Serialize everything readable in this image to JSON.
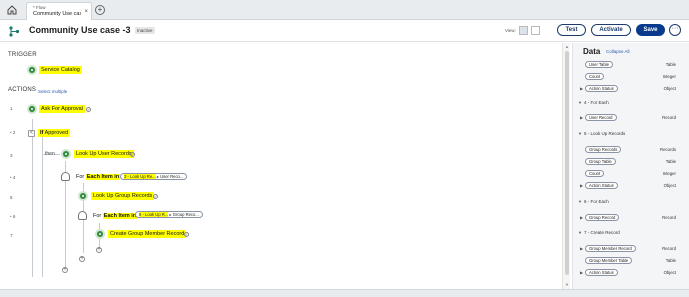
{
  "tab": {
    "subtitle": "* Flow",
    "title": "Community Use cas...",
    "close": "×"
  },
  "header": {
    "title": "Community Use case -3",
    "status": "Inactive",
    "view_label": "View:",
    "test_label": "Test",
    "activate_label": "Activate",
    "save_label": "Save",
    "more_label": "···"
  },
  "canvas": {
    "trigger_label": "TRIGGER",
    "trigger_name": "Service Catalog",
    "actions_label": "ACTIONS",
    "select_multiple": "Select multiple",
    "then_label": "then",
    "rows": [
      {
        "num": "1",
        "label": "Ask For Approval"
      },
      {
        "num": "2",
        "if_keyword": "If",
        "label": "Approved"
      },
      {
        "num": "3",
        "label": "Look Up User Records"
      },
      {
        "num": "4",
        "for_prefix": "For",
        "for_bold": "Each Item in",
        "pill_hl": "3 - Look Up Re...",
        "pill_rest": "User Reco..."
      },
      {
        "num": "5",
        "label": "Look Up Group Records"
      },
      {
        "num": "6",
        "for_prefix": "For",
        "for_bold": "Each Item in",
        "pill_hl": "5 - Look Up R...",
        "pill_rest": "Group Reco..."
      },
      {
        "num": "7",
        "label": "Create Group Member Record"
      }
    ]
  },
  "panel": {
    "title": "Data",
    "collapse_all": "Collapse All",
    "top_items": [
      {
        "label": "User Table",
        "type": "Table"
      },
      {
        "label": "Count",
        "type": "Integer"
      },
      {
        "label": "Action Status",
        "type": "Object"
      }
    ],
    "sections": [
      {
        "title": "4 - For Each",
        "items": [
          {
            "label": "User Record",
            "type": "Record"
          }
        ]
      },
      {
        "title": "5 - Look Up Records",
        "items": [
          {
            "label": "Group Records",
            "type": "Records"
          },
          {
            "label": "Group Table",
            "type": "Table"
          },
          {
            "label": "Count",
            "type": "Integer"
          },
          {
            "label": "Action Status",
            "type": "Object"
          }
        ]
      },
      {
        "title": "6 - For Each",
        "items": [
          {
            "label": "Group Record",
            "type": "Record"
          }
        ]
      },
      {
        "title": "7 - Create Record",
        "items": [
          {
            "label": "Group Member Record",
            "type": "Record"
          },
          {
            "label": "Group Member Table",
            "type": "Table"
          },
          {
            "label": "Action Status",
            "type": "Object"
          }
        ]
      }
    ]
  },
  "colors": {
    "highlight": "#ffff00",
    "node_green": "#2f8a3c",
    "primary_navy": "#0a3a8c"
  }
}
